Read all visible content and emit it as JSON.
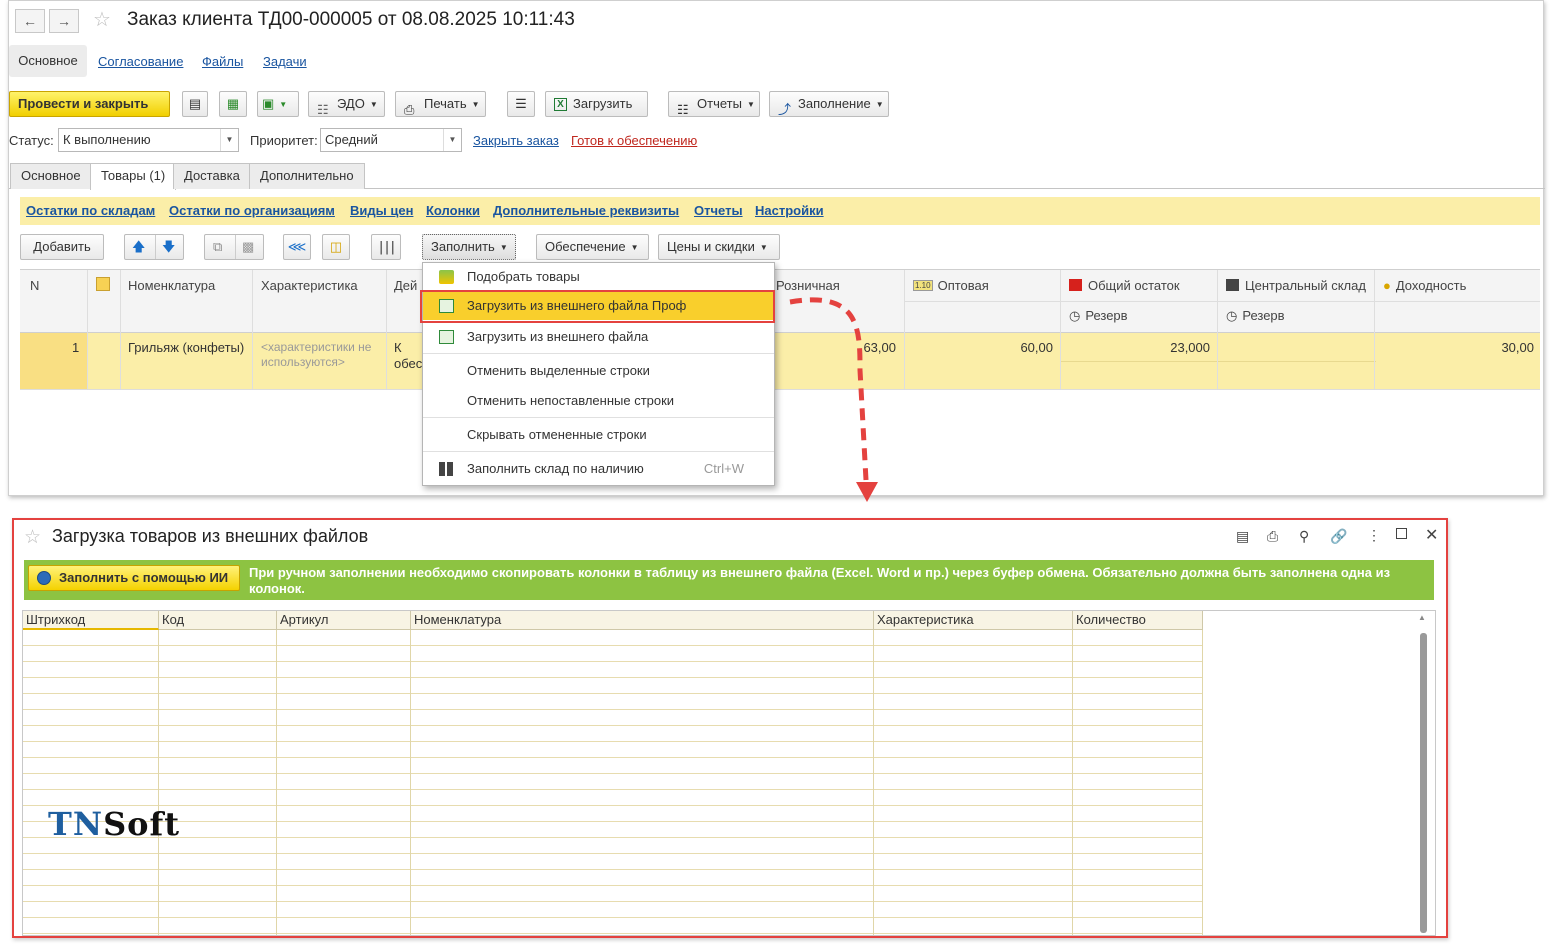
{
  "order_form": {
    "title": "Заказ клиента ТД00-000005 от 08.08.2025 10:11:43",
    "nav_tabs": [
      "Основное",
      "Согласование",
      "Файлы",
      "Задачи"
    ],
    "toolbar": {
      "post_and_close": "Провести и закрыть",
      "edo": "ЭДО",
      "print": "Печать",
      "load": "Загрузить",
      "reports": "Отчеты",
      "filling": "Заполнение"
    },
    "status_label": "Статус:",
    "status_value": "К выполнению",
    "priority_label": "Приоритет:",
    "priority_value": "Средний",
    "close_order_link": "Закрыть заказ",
    "ready_link": "Готов к обеспечению",
    "tabs": [
      "Основное",
      "Товары (1)",
      "Доставка",
      "Дополнительно"
    ],
    "yellow_links": [
      "Остатки по складам",
      "Остатки по организациям",
      "Виды цен",
      "Колонки",
      "Дополнительные реквизиты",
      "Отчеты",
      "Настройки"
    ],
    "goods_toolbar": {
      "add": "Добавить",
      "fill": "Заполнить",
      "provision": "Обеспечение",
      "prices": "Цены и скидки"
    },
    "columns": {
      "n": "N",
      "nomenclature": "Номенклатура",
      "characteristic": "Характеристика",
      "action": "Дей",
      "retail": "Розничная",
      "wholesale": "Оптовая",
      "total_stock": "Общий остаток",
      "central_stock": "Центральный склад",
      "reserve": "Резерв",
      "profit": "Доходность"
    },
    "row": {
      "n": "1",
      "nomenclature": "Грильяж (конфеты)",
      "characteristic": "<характеристики не используются>",
      "action_a": "К",
      "action_b": "обес",
      "retail": "63,00",
      "wholesale": "60,00",
      "total_stock": "23,000",
      "profit": "30,00"
    }
  },
  "fill_menu": {
    "items": [
      {
        "label": "Подобрать товары",
        "icon": "pick-goods-icon"
      },
      {
        "label": "Загрузить из внешнего файла Проф",
        "icon": "load-file-icon"
      },
      {
        "label": "Загрузить из внешнего файла",
        "icon": "load-file-icon"
      },
      {
        "label": "Отменить выделенные строки"
      },
      {
        "label": "Отменить непоставленные строки"
      },
      {
        "label": "Скрывать отмененные строки"
      },
      {
        "label": "Заполнить склад по наличию",
        "shortcut": "Ctrl+W",
        "icon": "grid-icon"
      }
    ]
  },
  "import_form": {
    "title": "Загрузка товаров из внешних файлов",
    "ai_button": "Заполнить с помощью ИИ",
    "hint": "При ручном заполнении необходимо скопировать колонки в таблицу из внешнего файла (Excel. Word и пр.) через буфер обмена. Обязательно должна быть заполнена одна из колонок.",
    "columns": [
      "Штрихкод",
      "Код",
      "Артикул",
      "Номенклатура",
      "Характеристика",
      "Количество"
    ]
  },
  "watermark": {
    "part1": "TN",
    "part2": "Soft"
  },
  "colors": {
    "accent_red": "#e4423f",
    "highlight": "#f5c518",
    "green_bar": "#8dc342"
  }
}
